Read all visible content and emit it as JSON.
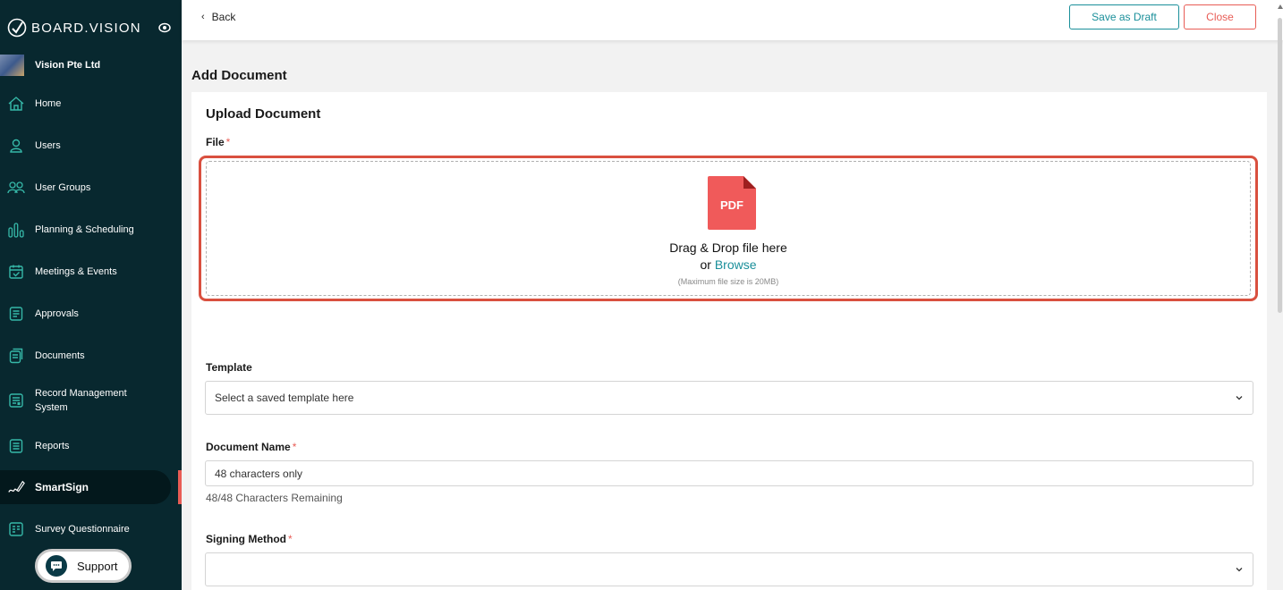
{
  "brand": {
    "name": "BOARD.VISION"
  },
  "org": {
    "name": "Vision Pte Ltd"
  },
  "sidebar": {
    "items": [
      {
        "label": "Home",
        "icon": "home-icon"
      },
      {
        "label": "Users",
        "icon": "user-icon"
      },
      {
        "label": "User Groups",
        "icon": "user-group-icon"
      },
      {
        "label": "Planning & Scheduling",
        "icon": "planning-icon"
      },
      {
        "label": "Meetings & Events",
        "icon": "calendar-icon"
      },
      {
        "label": "Approvals",
        "icon": "approvals-icon"
      },
      {
        "label": "Documents",
        "icon": "documents-icon"
      },
      {
        "label": "Record Management",
        "label2": "System",
        "icon": "record-management-icon"
      },
      {
        "label": "Reports",
        "icon": "reports-icon"
      },
      {
        "label": "SmartSign",
        "icon": "smartsign-icon",
        "active": true
      },
      {
        "label": "Survey Questionnaire",
        "icon": "survey-icon"
      }
    ],
    "support_label": "Support"
  },
  "topbar": {
    "back_label": "Back",
    "save_draft_label": "Save as Draft",
    "close_label": "Close"
  },
  "page": {
    "title": "Add Document",
    "section_title": "Upload Document"
  },
  "form": {
    "file": {
      "label": "File",
      "required": "*",
      "pdf_label": "PDF",
      "drop_text": "Drag & Drop file here",
      "or_text": "or",
      "browse_text": "Browse",
      "max_size_text": "(Maximum file size is 20MB)"
    },
    "template": {
      "label": "Template",
      "placeholder": "Select a saved template here"
    },
    "document_name": {
      "label": "Document Name",
      "required": "*",
      "placeholder": "48 characters only",
      "remaining": "48/48 Characters Remaining"
    },
    "signing_method": {
      "label": "Signing Method",
      "required": "*",
      "value": ""
    }
  },
  "colors": {
    "sidebar_bg": "#08282f",
    "accent_teal": "#1a8f9a",
    "accent_red": "#e85c55",
    "pdf_red": "#f05a5a"
  }
}
